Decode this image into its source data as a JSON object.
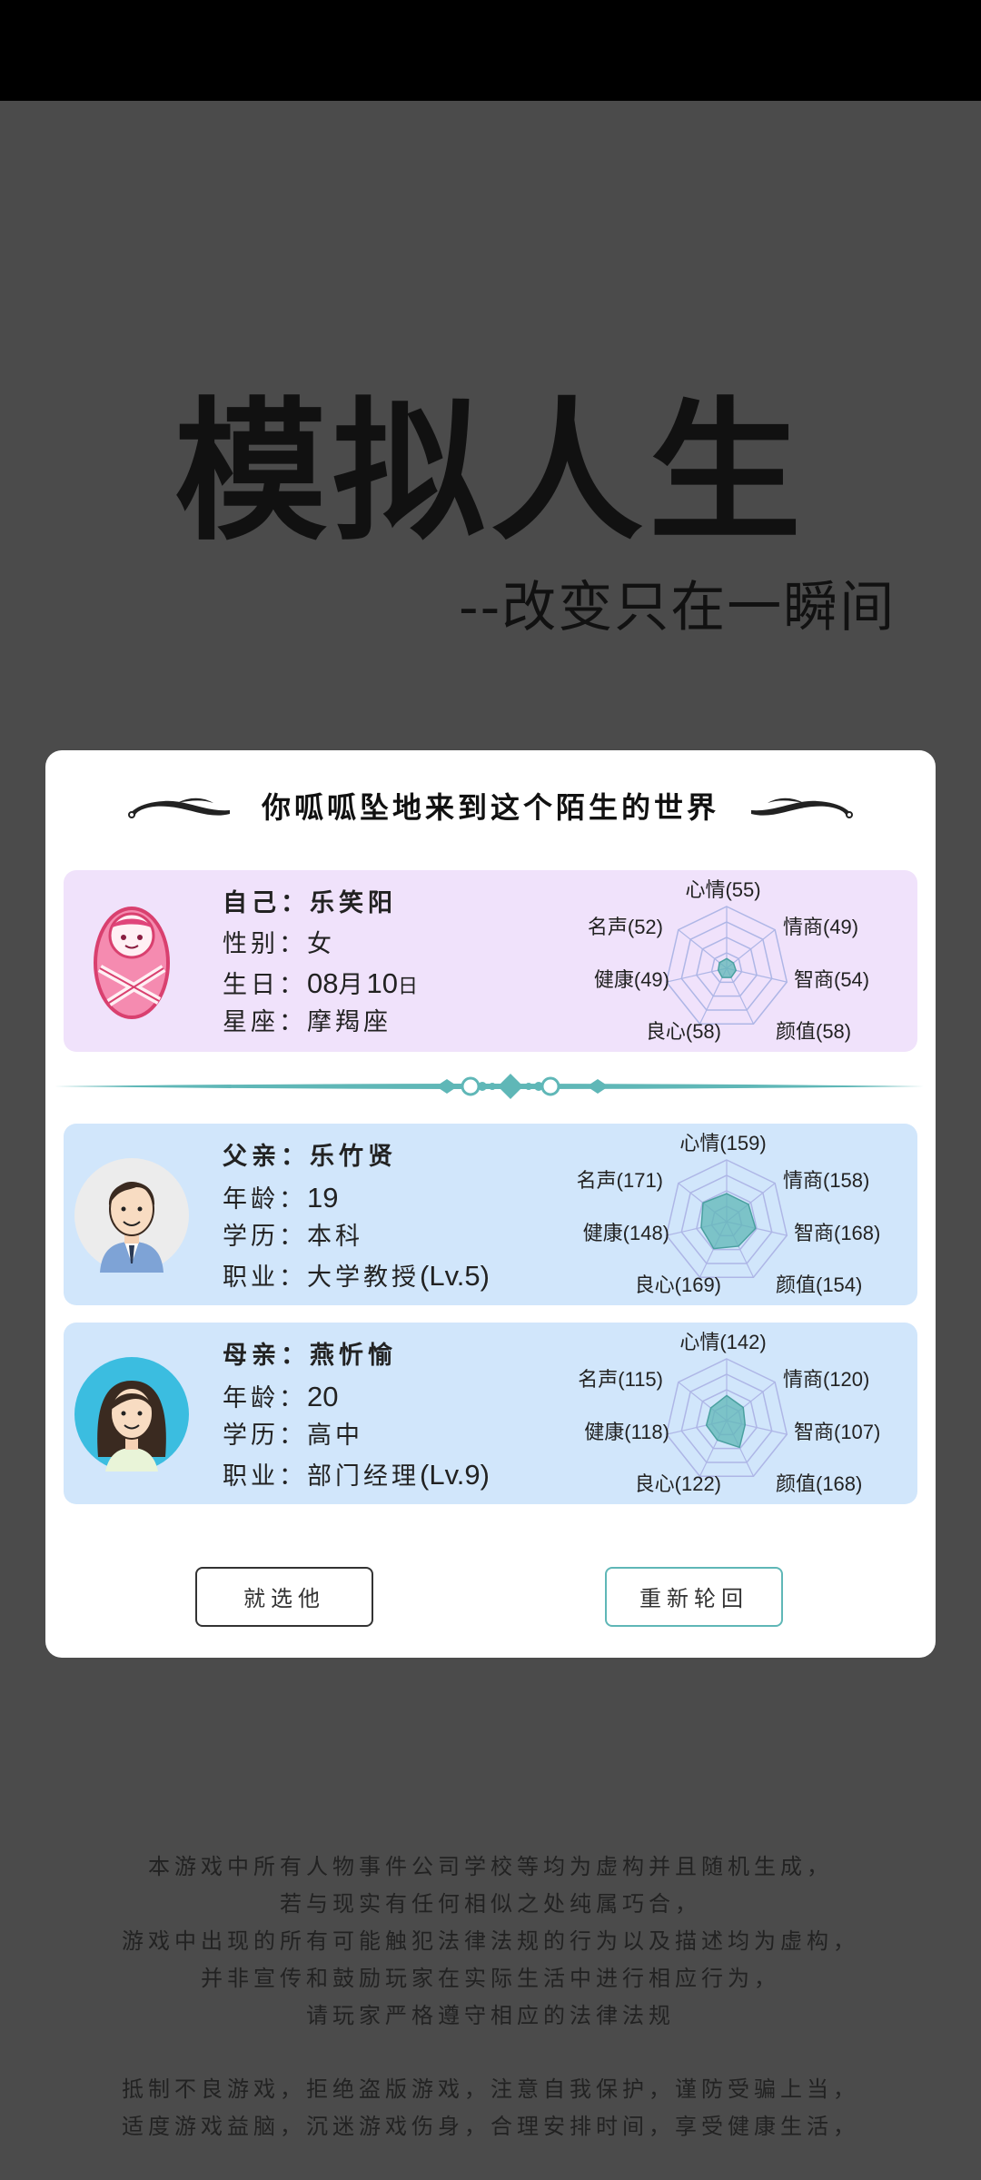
{
  "app": {
    "title": "模拟人生",
    "subtitle": "--改变只在一瞬间"
  },
  "dialog": {
    "header": "你呱呱坠地来到这个陌生的世界",
    "self": {
      "name_label": "自己：乐笑阳",
      "rows": [
        {
          "label": "性别：",
          "value": "女"
        },
        {
          "label": "生日：",
          "value_parts": [
            "08",
            "月",
            "10",
            "日"
          ]
        },
        {
          "label": "星座：",
          "value": "摩羯座"
        }
      ],
      "stats": {
        "mood": "心情(55)",
        "eq": "情商(49)",
        "iq": "智商(54)",
        "looks": "颜值(58)",
        "conscience": "良心(58)",
        "health": "健康(49)",
        "fame": "名声(52)"
      },
      "stat_values": [
        55,
        49,
        54,
        58,
        58,
        49,
        52
      ]
    },
    "father": {
      "name_label": "父亲：乐竹贤",
      "rows": [
        {
          "label": "年龄：",
          "value": "19"
        },
        {
          "label": "学历：",
          "value": "本科"
        },
        {
          "label": "职业：",
          "value": "大学教授",
          "level": "(Lv.5)"
        }
      ],
      "stats": {
        "mood": "心情(159)",
        "eq": "情商(158)",
        "iq": "智商(168)",
        "looks": "颜值(154)",
        "conscience": "良心(169)",
        "health": "健康(148)",
        "fame": "名声(171)"
      },
      "stat_values": [
        159,
        158,
        168,
        154,
        169,
        148,
        171
      ]
    },
    "mother": {
      "name_label": "母亲：燕忻愉",
      "rows": [
        {
          "label": "年龄：",
          "value": "20"
        },
        {
          "label": "学历：",
          "value": "高中"
        },
        {
          "label": "职业：",
          "value": "部门经理",
          "level": "(Lv.9)"
        }
      ],
      "stats": {
        "mood": "心情(142)",
        "eq": "情商(120)",
        "iq": "智商(107)",
        "looks": "颜值(168)",
        "conscience": "良心(122)",
        "health": "健康(118)",
        "fame": "名声(115)"
      },
      "stat_values": [
        142,
        120,
        107,
        168,
        122,
        118,
        115
      ]
    },
    "buttons": {
      "pick": "就选他",
      "reborn": "重新轮回"
    },
    "colors": {
      "accent": "#5fb7b7",
      "self_card": "#f0e2fb",
      "parent_card": "#d1e6fb"
    }
  },
  "disclaimer": {
    "lines": [
      "本游戏中所有人物事件公司学校等均为虚构并且随机生成，",
      "若与现实有任何相似之处纯属巧合，",
      "游戏中出现的所有可能触犯法律法规的行为以及描述均为虚构，",
      "并非宣传和鼓励玩家在实际生活中进行相应行为，",
      "请玩家严格遵守相应的法律法规"
    ],
    "health_lines": [
      "抵制不良游戏，拒绝盗版游戏，注意自我保护，谨防受骗上当，",
      "适度游戏益脑，沉迷游戏伤身，合理安排时间，享受健康生活，"
    ]
  }
}
